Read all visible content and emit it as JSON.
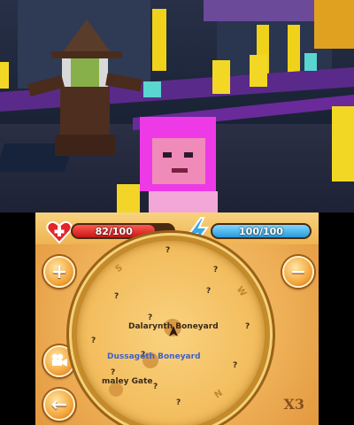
{
  "hud": {
    "health_label": "82/100",
    "health_value": 82,
    "health_max": 100,
    "energy_label": "100/100",
    "energy_value": 100,
    "energy_max": 100,
    "health_color": "#e3262b",
    "energy_color": "#3fb0ea"
  },
  "map": {
    "directions": {
      "north": "N",
      "south": "S",
      "west": "W"
    },
    "locations": [
      {
        "name": "Dalarynth Boneyard",
        "color": "#3a2a1a"
      },
      {
        "name": "Dussagoth Boneyard",
        "color": "#4060c8"
      },
      {
        "name": "maley Gate",
        "color": "#3a2a1a"
      }
    ],
    "unknown_marker": "?",
    "zoom_label": "X3"
  },
  "buttons": {
    "zoom_in": "+",
    "zoom_out": "−",
    "back": "←"
  },
  "icons": {
    "health": "heart-icon",
    "energy": "lightning-icon",
    "camera": "camera-icon",
    "player": "player-arrow-icon"
  }
}
